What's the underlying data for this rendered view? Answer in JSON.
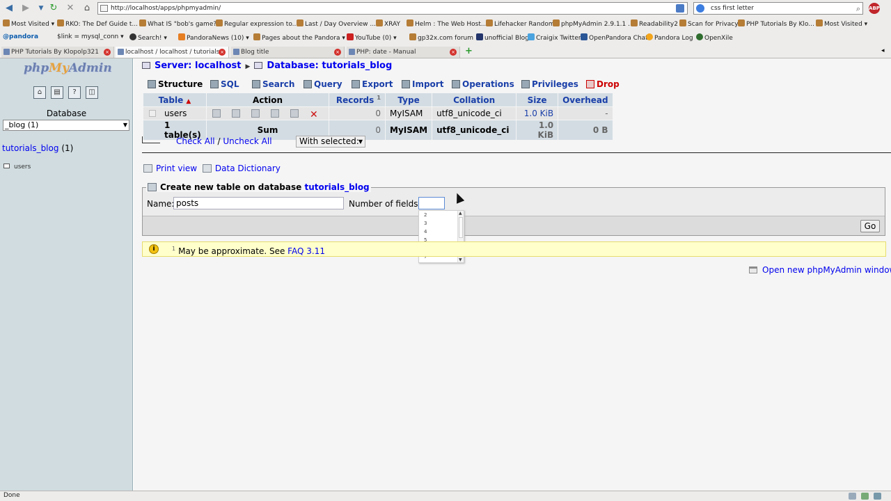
{
  "browser": {
    "url": "http://localhost/apps/phpmyadmin/",
    "search": "css first letter",
    "abp": "ABP",
    "status": "Done",
    "bookmarks_row1": [
      "Most Visited",
      "RKO: The Def Guide t...",
      "What IS \"bob's game?\"",
      "Regular expression to...",
      "Last / Day Overview ...",
      "XRAY",
      "Helm : The Web Host...",
      "Lifehacker Random",
      "phpMyAdmin 2.9.1.1 ...",
      "Readability2",
      "Scan for Privacy",
      "PHP Tutorials By Klo...",
      "Most Visited"
    ],
    "bookmarks_row2": [
      "pandora",
      "$link = mysql_conn",
      "Search!",
      "PandoraNews (10)",
      "Pages about the Pandora",
      "YouTube (0)",
      "gp32x.com forum",
      "unofficial Blog",
      "Craigix Twitter",
      "OpenPandora Chat",
      "Pandora Log",
      "OpenXile"
    ],
    "tabs": [
      "PHP Tutorials By Klopolp321",
      "localhost / localhost / tutorials",
      "Blog title",
      "PHP: date - Manual"
    ]
  },
  "sidebar": {
    "logo_a": "php",
    "logo_b": "My",
    "logo_c": "Admin",
    "db_label": "Database",
    "db_select": "_blog (1)",
    "db_link": "tutorials_blog",
    "db_count": "(1)",
    "tables": [
      "users"
    ]
  },
  "breadcrumb": {
    "server": "Server: localhost",
    "database": "Database: tutorials_blog"
  },
  "tabs": [
    {
      "label": "Structure"
    },
    {
      "label": "SQL"
    },
    {
      "label": "Search"
    },
    {
      "label": "Query"
    },
    {
      "label": "Export"
    },
    {
      "label": "Import"
    },
    {
      "label": "Operations"
    },
    {
      "label": "Privileges"
    },
    {
      "label": "Drop"
    }
  ],
  "table": {
    "headers": {
      "table": "Table",
      "action": "Action",
      "records": "Records",
      "records_sup": "1",
      "type": "Type",
      "collation": "Collation",
      "size": "Size",
      "overhead": "Overhead"
    },
    "rows": [
      {
        "name": "users",
        "records": "0",
        "type": "MyISAM",
        "collation": "utf8_unicode_ci",
        "size": "1.0 KiB",
        "overhead": "-"
      }
    ],
    "summary": {
      "name": "1 table(s)",
      "action": "Sum",
      "records": "0",
      "type": "MyISAM",
      "collation": "utf8_unicode_ci",
      "size": "1.0 KiB",
      "overhead": "0 B"
    }
  },
  "bulk": {
    "check_all": "Check All",
    "slash": "/",
    "uncheck_all": "Uncheck All",
    "with_selected": "With selected:"
  },
  "links": {
    "print_view": "Print view",
    "data_dictionary": "Data Dictionary"
  },
  "create": {
    "legend": "Create new table on database",
    "legend_db": "tutorials_blog",
    "name_label": "Name:",
    "name_value": "posts",
    "fields_label": "Number of fields:",
    "fields_value": "",
    "go": "Go",
    "dropdown_options": [
      "2",
      "3",
      "4",
      "5",
      "6",
      "7"
    ]
  },
  "notice": {
    "sup": "1",
    "text": "May be approximate. See",
    "link": "FAQ 3.11"
  },
  "open_new": "Open new phpMyAdmin window"
}
